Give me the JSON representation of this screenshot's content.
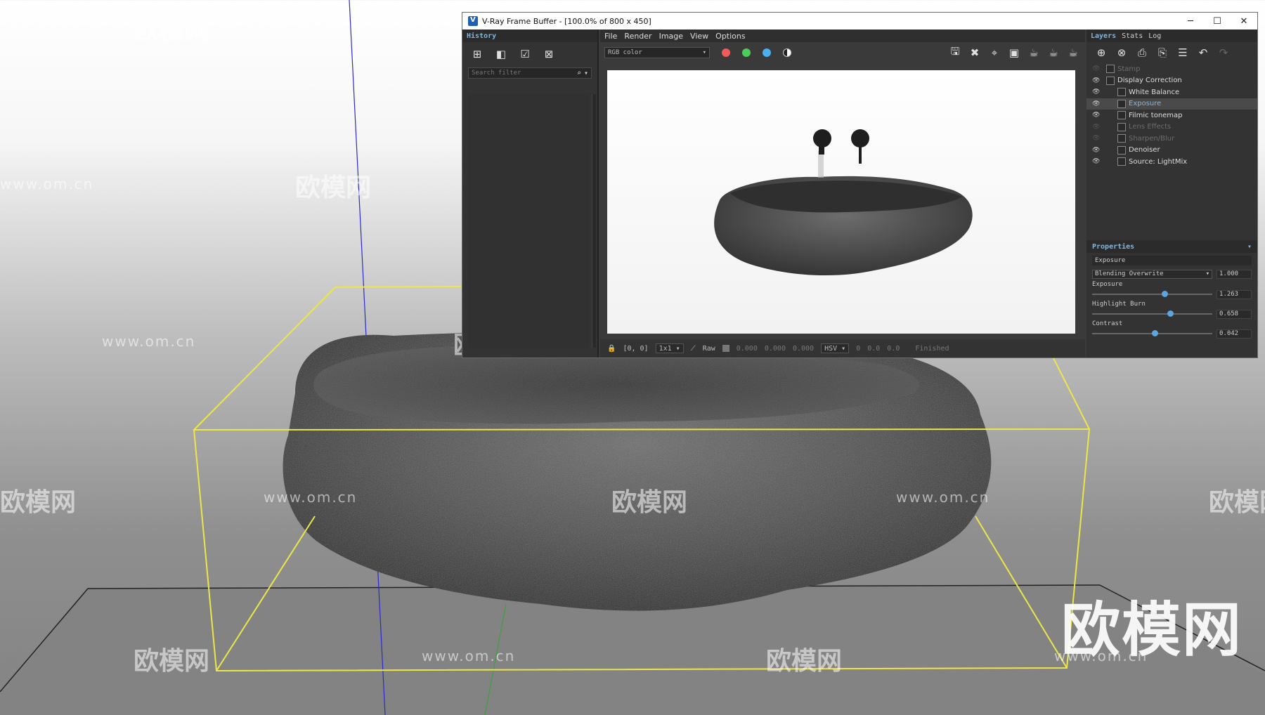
{
  "watermarks": {
    "brand_cn": "欧模网",
    "url": "www.om.cn"
  },
  "vfb": {
    "title": "V-Ray Frame Buffer - [100.0% of 800 x 450]",
    "window_controls": [
      "─",
      "☐",
      "✕"
    ],
    "history": {
      "header": "History",
      "search_placeholder": "Search filter"
    },
    "menu": [
      "File",
      "Render",
      "Image",
      "View",
      "Options"
    ],
    "channel_select": "RGB color",
    "channel_dots": [
      {
        "name": "red-channel",
        "color": "#f05a5a"
      },
      {
        "name": "green-channel",
        "color": "#4ccd5a"
      },
      {
        "name": "blue-channel",
        "color": "#4ab0f0"
      }
    ],
    "status": {
      "coords": "[0, 0]",
      "zoom": "1x1",
      "mode": "Raw",
      "v1": "0.000",
      "v2": "0.000",
      "v3": "0.000",
      "color_space": "HSV",
      "h": "0",
      "s": "0.0",
      "v": "0.0",
      "state": "Finished"
    },
    "layers": {
      "tabs": [
        "Layers",
        "Stats",
        "Log"
      ],
      "active_tab": "Layers",
      "items": [
        {
          "name": "Stamp",
          "enabled": false,
          "child": false
        },
        {
          "name": "Display Correction",
          "enabled": true,
          "child": false
        },
        {
          "name": "White Balance",
          "enabled": true,
          "child": true
        },
        {
          "name": "Exposure",
          "enabled": true,
          "child": true,
          "selected": true
        },
        {
          "name": "Filmic tonemap",
          "enabled": true,
          "child": true
        },
        {
          "name": "Lens Effects",
          "enabled": false,
          "child": true
        },
        {
          "name": "Sharpen/Blur",
          "enabled": false,
          "child": true
        },
        {
          "name": "Denoiser",
          "enabled": true,
          "child": true
        },
        {
          "name": "Source: LightMix",
          "enabled": true,
          "child": true
        }
      ]
    },
    "properties": {
      "header": "Properties",
      "title": "Exposure",
      "blending_label": "Blending Overwrite",
      "blending_value": "1.000",
      "params": [
        {
          "label": "Exposure",
          "value": "1.263",
          "fraction": 0.6
        },
        {
          "label": "Highlight Burn",
          "value": "0.658",
          "fraction": 0.65
        },
        {
          "label": "Contrast",
          "value": "0.042",
          "fraction": 0.52
        }
      ]
    }
  }
}
